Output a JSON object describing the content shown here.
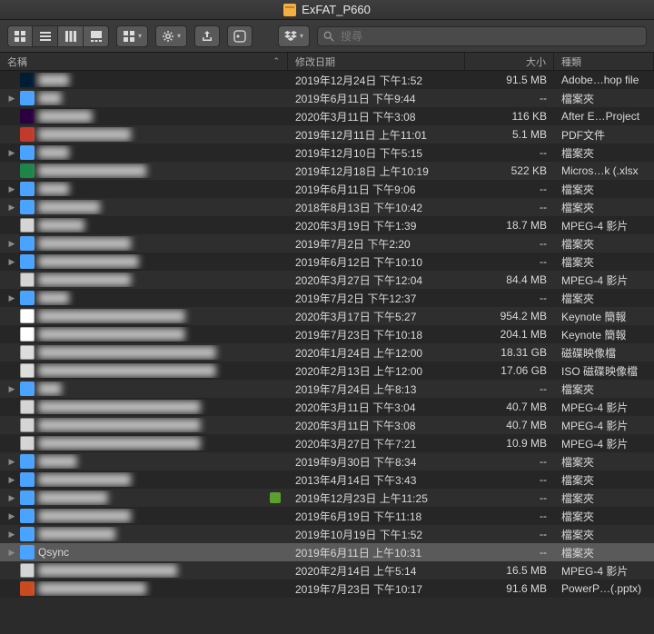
{
  "window": {
    "title": "ExFAT_P660"
  },
  "toolbar": {
    "search_placeholder": "搜尋"
  },
  "columns": {
    "name": "名稱",
    "date": "修改日期",
    "size": "大小",
    "kind": "種類"
  },
  "rows": [
    {
      "expandable": false,
      "icon": "psd",
      "name": "████",
      "blur": true,
      "date": "2019年12月24日 下午1:52",
      "size": "91.5 MB",
      "kind": "Adobe…hop file"
    },
    {
      "expandable": true,
      "icon": "folder",
      "name": "███",
      "blur": true,
      "date": "2019年6月11日 下午9:44",
      "size": "--",
      "kind": "檔案夾"
    },
    {
      "expandable": false,
      "icon": "ae",
      "name": "███████",
      "blur": true,
      "date": "2020年3月11日 下午3:08",
      "size": "116 KB",
      "kind": "After E…Project"
    },
    {
      "expandable": false,
      "icon": "pdf",
      "name": "████████████",
      "blur": true,
      "date": "2019年12月11日 上午11:01",
      "size": "5.1 MB",
      "kind": "PDF文件"
    },
    {
      "expandable": true,
      "icon": "folder",
      "name": "████",
      "blur": true,
      "date": "2019年12月10日 下午5:15",
      "size": "--",
      "kind": "檔案夾"
    },
    {
      "expandable": false,
      "icon": "xls",
      "name": "██████████████",
      "blur": true,
      "date": "2019年12月18日 上午10:19",
      "size": "522 KB",
      "kind": "Micros…k (.xlsx"
    },
    {
      "expandable": true,
      "icon": "folder",
      "name": "████",
      "blur": true,
      "date": "2019年6月11日 下午9:06",
      "size": "--",
      "kind": "檔案夾"
    },
    {
      "expandable": true,
      "icon": "folder",
      "name": "████████",
      "blur": true,
      "date": "2018年8月13日 下午10:42",
      "size": "--",
      "kind": "檔案夾"
    },
    {
      "expandable": false,
      "icon": "mp4",
      "name": "██████",
      "blur": true,
      "date": "2020年3月19日 下午1:39",
      "size": "18.7 MB",
      "kind": "MPEG-4 影片"
    },
    {
      "expandable": true,
      "icon": "folder",
      "name": "████████████",
      "blur": true,
      "date": "2019年7月2日 下午2:20",
      "size": "--",
      "kind": "檔案夾"
    },
    {
      "expandable": true,
      "icon": "folder",
      "name": "█████████████",
      "blur": true,
      "date": "2019年6月12日 下午10:10",
      "size": "--",
      "kind": "檔案夾"
    },
    {
      "expandable": false,
      "icon": "mp4",
      "name": "████████████",
      "blur": true,
      "date": "2020年3月27日 下午12:04",
      "size": "84.4 MB",
      "kind": "MPEG-4 影片"
    },
    {
      "expandable": true,
      "icon": "folder",
      "name": "████",
      "blur": true,
      "date": "2019年7月2日 下午12:37",
      "size": "--",
      "kind": "檔案夾"
    },
    {
      "expandable": false,
      "icon": "key",
      "name": "███████████████████",
      "blur": true,
      "date": "2020年3月17日 下午5:27",
      "size": "954.2 MB",
      "kind": "Keynote 簡報"
    },
    {
      "expandable": false,
      "icon": "key",
      "name": "███████████████████",
      "blur": true,
      "date": "2019年7月23日 下午10:18",
      "size": "204.1 MB",
      "kind": "Keynote 簡報"
    },
    {
      "expandable": false,
      "icon": "dmg",
      "name": "███████████████████████",
      "blur": true,
      "date": "2020年1月24日 上午12:00",
      "size": "18.31 GB",
      "kind": "磁碟映像檔"
    },
    {
      "expandable": false,
      "icon": "dmg",
      "name": "███████████████████████",
      "blur": true,
      "date": "2020年2月13日 上午12:00",
      "size": "17.06 GB",
      "kind": "ISO 磁碟映像檔"
    },
    {
      "expandable": true,
      "icon": "folder",
      "name": "███",
      "blur": true,
      "date": "2019年7月24日 上午8:13",
      "size": "--",
      "kind": "檔案夾"
    },
    {
      "expandable": false,
      "icon": "mp4",
      "name": "█████████████████████",
      "blur": true,
      "date": "2020年3月11日 下午3:04",
      "size": "40.7 MB",
      "kind": "MPEG-4 影片"
    },
    {
      "expandable": false,
      "icon": "mp4",
      "name": "█████████████████████",
      "blur": true,
      "date": "2020年3月11日 下午3:08",
      "size": "40.7 MB",
      "kind": "MPEG-4 影片"
    },
    {
      "expandable": false,
      "icon": "mp4",
      "name": "█████████████████████",
      "blur": true,
      "date": "2020年3月27日 下午7:21",
      "size": "10.9 MB",
      "kind": "MPEG-4 影片"
    },
    {
      "expandable": true,
      "icon": "folder",
      "name": "█████",
      "blur": true,
      "date": "2019年9月30日 下午8:34",
      "size": "--",
      "kind": "檔案夾"
    },
    {
      "expandable": true,
      "icon": "folder",
      "name": "████████████",
      "blur": true,
      "date": "2013年4月14日 下午3:43",
      "size": "--",
      "kind": "檔案夾"
    },
    {
      "expandable": true,
      "icon": "folder",
      "name": "█████████",
      "blur": true,
      "date": "2019年12月23日 上午11:25",
      "size": "--",
      "kind": "檔案夾",
      "badge": "green"
    },
    {
      "expandable": true,
      "icon": "folder",
      "name": "████████████",
      "blur": true,
      "date": "2019年6月19日 下午11:18",
      "size": "--",
      "kind": "檔案夾"
    },
    {
      "expandable": true,
      "icon": "folder",
      "name": "██████████",
      "blur": true,
      "date": "2019年10月19日 下午1:52",
      "size": "--",
      "kind": "檔案夾"
    },
    {
      "expandable": true,
      "icon": "folder",
      "name": "Qsync",
      "blur": false,
      "date": "2019年6月11日 上午10:31",
      "size": "--",
      "kind": "檔案夾",
      "selected": true
    },
    {
      "expandable": false,
      "icon": "mp4",
      "name": "██████████████████",
      "blur": true,
      "date": "2020年2月14日 上午5:14",
      "size": "16.5 MB",
      "kind": "MPEG-4 影片"
    },
    {
      "expandable": false,
      "icon": "ppt",
      "name": "██████████████",
      "blur": true,
      "date": "2019年7月23日 下午10:17",
      "size": "91.6 MB",
      "kind": "PowerP…(.pptx)"
    }
  ]
}
